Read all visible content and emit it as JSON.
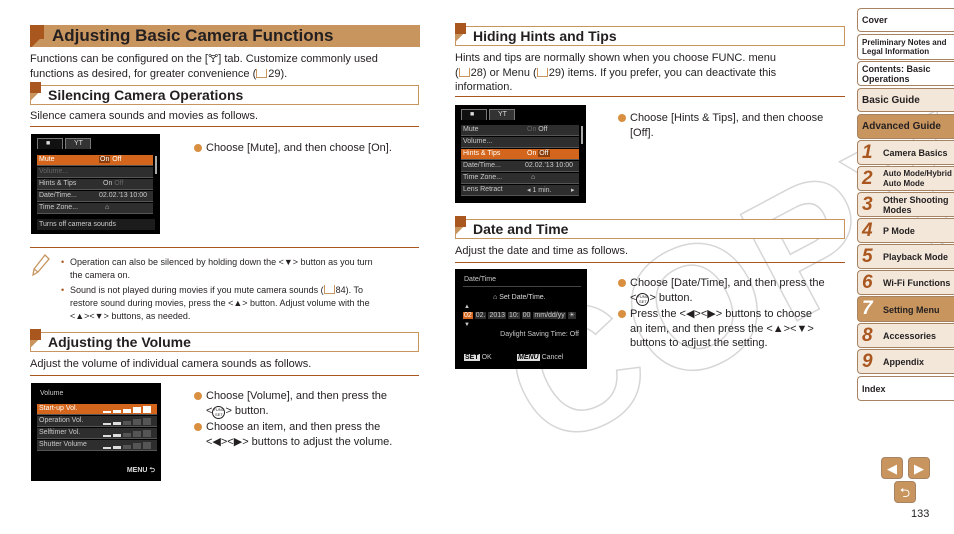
{
  "title": "Adjusting Basic Camera Functions",
  "intro": [
    "Functions can be configured on the [ꝉꝉ] tab. Customize commonly used",
    "functions as desired, for greater convenience (",
    "29)."
  ],
  "intro_line1": "Functions can be configured on the [🝖] tab. Customize commonly used",
  "intro_line2_pre": "functions as desired, for greater convenience (",
  "intro_line2_ref": "29",
  "intro_line2_post": ").",
  "sections": {
    "silencing": {
      "heading": "Silencing Camera Operations",
      "desc": "Silence camera sounds and movies as follows.",
      "step": "Choose [Mute], and then choose [On].",
      "screen": {
        "tab_camera": "camera-icon",
        "tab_setup": "wrench-icon",
        "rows": [
          {
            "label": "Mute",
            "on": "On",
            "off": "Off"
          },
          {
            "label": "Volume..."
          },
          {
            "label": "Hints & Tips",
            "on": "On",
            "off": "Off"
          },
          {
            "label": "Date/Time...",
            "value": "02.02.'13 10:00"
          },
          {
            "label": "Time Zone...",
            "value": "home-icon"
          }
        ],
        "hint": "Turns off camera sounds"
      },
      "notes": [
        {
          "line1": "Operation can also be silenced by holding down the <▼> button as you turn",
          "line2": "the camera on."
        },
        {
          "line1_pre": "Sound is not played during movies if you mute camera sounds (",
          "line1_ref": "84",
          "line1_post": "). To",
          "line2": "restore sound during movies, press the <▲> button. Adjust volume with the",
          "line3": "<▲><▼> buttons, as needed."
        }
      ]
    },
    "volume": {
      "heading": "Adjusting the Volume",
      "desc": "Adjust the volume of individual camera sounds as follows.",
      "steps": [
        {
          "pre": "Choose [Volume], and then press the",
          "line2_pre": "<",
          "line2_post": "> button."
        },
        {
          "line1": "Choose an item, and then press the",
          "line2": "<◀><▶> buttons to adjust the volume."
        }
      ],
      "screen": {
        "title": "Volume",
        "rows": [
          {
            "label": "Start-up Vol.",
            "level": 5
          },
          {
            "label": "Operation Vol.",
            "level": 2
          },
          {
            "label": "Selftimer Vol.",
            "level": 2
          },
          {
            "label": "Shutter Volume",
            "level": 2
          }
        ],
        "max_level": 5,
        "footer": "MENU ⮌"
      }
    },
    "hints": {
      "heading": "Hiding Hints and Tips",
      "desc_line1": "Hints and tips are normally shown when you choose FUNC. menu",
      "desc_line2_a": "(",
      "desc_ref1": "28",
      "desc_line2_b": ") or Menu (",
      "desc_ref2": "29",
      "desc_line2_c": ") items. If you prefer, you can deactivate this",
      "desc_line3": "information.",
      "step_line1": "Choose [Hints & Tips], and then choose",
      "step_line2": "[Off].",
      "screen": {
        "rows": [
          {
            "label": "Mute",
            "on": "On",
            "off": "Off"
          },
          {
            "label": "Volume..."
          },
          {
            "label": "Hints & Tips",
            "on": "On",
            "off": "Off"
          },
          {
            "label": "Date/Time...",
            "value": "02.02.'13 10:00"
          },
          {
            "label": "Time Zone...",
            "value": "home-icon"
          },
          {
            "label": "Lens Retract",
            "value": "◂ 1 min.",
            "arrow": "▸"
          }
        ]
      }
    },
    "datetime": {
      "heading": "Date and Time",
      "desc": "Adjust the date and time as follows.",
      "steps": [
        {
          "line1": "Choose [Date/Time], and then press the",
          "line2_pre": "<",
          "line2_post": "> button."
        },
        {
          "line1": "Press the <◀><▶> buttons to choose",
          "line2": "an item, and then press the <▲><▼>",
          "line3": "buttons to adjust the setting."
        }
      ],
      "screen": {
        "title": "Date/Time",
        "subtitle": "Set Date/Time.",
        "fields": [
          "02",
          "02.",
          "2013",
          "10:",
          "00",
          "mm/dd/yy"
        ],
        "dst": "Daylight Saving Time: Off",
        "set_label": "SET",
        "ok_label": "OK",
        "menu_label": "MENU",
        "cancel_label": "Cancel"
      }
    }
  },
  "sidebar": {
    "items": [
      {
        "label": "Cover"
      },
      {
        "label": "Preliminary Notes and",
        "label2": "Legal Information"
      },
      {
        "label": "Contents: Basic",
        "label2": "Operations"
      },
      {
        "label": "Basic Guide"
      },
      {
        "label": "Advanced Guide"
      }
    ],
    "chapters": [
      {
        "num": "1",
        "label": "Camera Basics"
      },
      {
        "num": "2",
        "label": "Auto Mode/Hybrid",
        "label2": "Auto Mode"
      },
      {
        "num": "3",
        "label": "Other Shooting",
        "label2": "Modes"
      },
      {
        "num": "4",
        "label": "P Mode"
      },
      {
        "num": "5",
        "label": "Playback Mode"
      },
      {
        "num": "6",
        "label": "Wi-Fi Functions"
      },
      {
        "num": "7",
        "label": "Setting Menu"
      },
      {
        "num": "8",
        "label": "Accessories"
      },
      {
        "num": "9",
        "label": "Appendix"
      }
    ],
    "index": "Index",
    "active_chapter": "7"
  },
  "nav": {
    "prev": "◀",
    "next": "▶",
    "back": "⮌"
  },
  "page_number": "133",
  "watermark": "COPY",
  "colors": {
    "accent": "#c8955f",
    "accent_dark": "#a9571f",
    "menu_highlight": "#d3661c"
  }
}
